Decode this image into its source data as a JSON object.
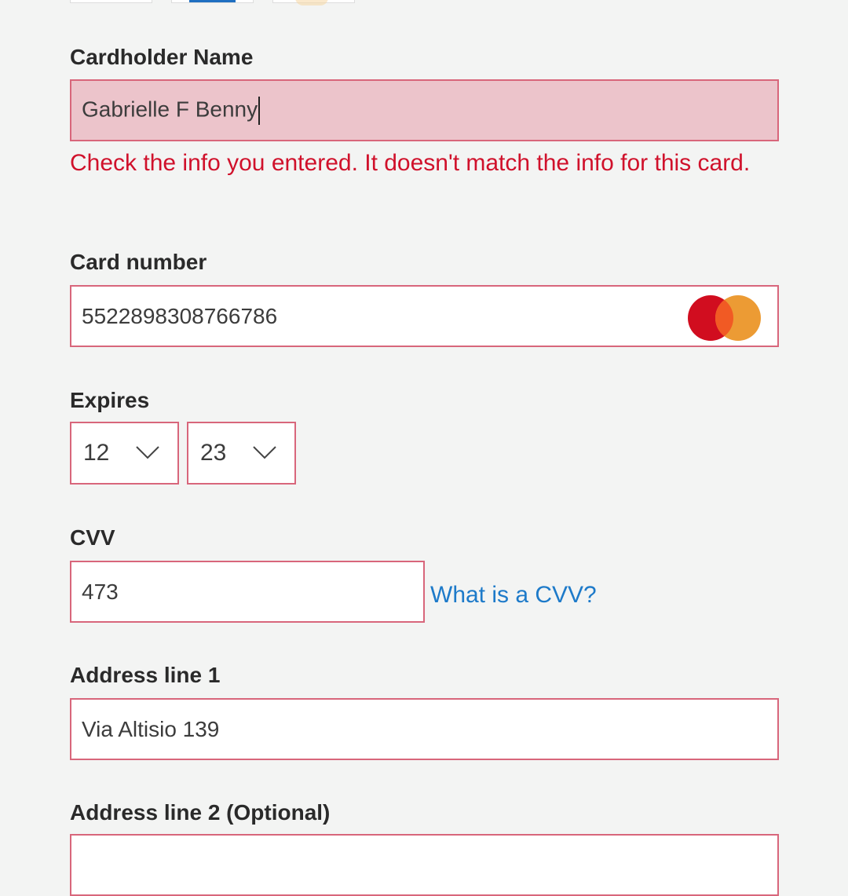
{
  "card_logos": [
    "visa-logo-icon",
    "amex-logo-icon",
    "discover-logo-icon"
  ],
  "cardholder": {
    "label": "Cardholder Name",
    "value": "Gabrielle F Benny",
    "error": "Check the info you entered. It doesn't match the info for this card."
  },
  "card_number": {
    "label": "Card number",
    "value": "5522898308766786",
    "brand_icon": "mastercard-logo-icon"
  },
  "expires": {
    "label": "Expires",
    "month": "12",
    "year": "23"
  },
  "cvv": {
    "label": "CVV",
    "value": "473",
    "help_link": "What is a CVV?"
  },
  "address1": {
    "label": "Address line 1",
    "value": "Via Altisio 139"
  },
  "address2": {
    "label": "Address line 2 (Optional)"
  },
  "colors": {
    "error_red": "#d0112b",
    "error_bg": "#ecc4cb",
    "field_border": "#d8667b",
    "link_blue": "#1d7ac9",
    "page_bg": "#f3f4f3",
    "mastercard_red": "#d10d1f",
    "mastercard_orange": "#ec9b34"
  }
}
